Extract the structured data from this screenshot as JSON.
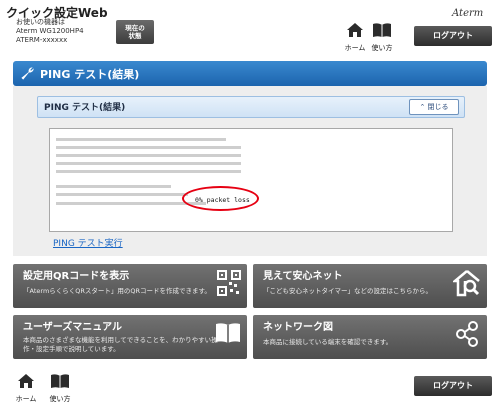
{
  "header": {
    "app_title": "クイック設定Web",
    "device_caption": "お使いの機器は",
    "device_model": "Aterm WG1200HP4",
    "device_ssid": "ATERM-xxxxxx",
    "status_button": [
      "現在の",
      "状態"
    ],
    "brand": "Aterm",
    "home_label": "ホーム",
    "help_label": "使い方",
    "logout_label": "ログアウト"
  },
  "page": {
    "title": "PING テスト(結果)",
    "panel_title": "PING テスト(結果)",
    "collapse_label": "閉じる",
    "highlight": "0% packet loss",
    "rerun_link": "PING テスト実行"
  },
  "tiles": [
    {
      "title": "設定用QRコードを表示",
      "desc": [
        "「AtermらくらくQRスタート」用のQRコードを作成できます。"
      ],
      "icon": "qr-code-icon"
    },
    {
      "title": "見えて安心ネット",
      "desc": [
        "「こども安心ネットタイマー」などの設定はこちらから。"
      ],
      "icon": "house-search-icon"
    },
    {
      "title": "ユーザーズマニュアル",
      "desc": [
        "本商品のさまざまな機能を利用してできることを、わかりやすい操",
        "作・設定手順で説明しています。"
      ],
      "icon": "book-icon"
    },
    {
      "title": "ネットワーク図",
      "desc": [
        "本商品に接続している端末を確認できます。"
      ],
      "icon": "network-icon"
    }
  ],
  "footer": {
    "home_label": "ホーム",
    "help_label": "使い方",
    "logout_label": "ログアウト"
  },
  "colors": {
    "accent": "#1c64ae",
    "highlight_circle": "#e60012",
    "link": "#1a66c4"
  }
}
